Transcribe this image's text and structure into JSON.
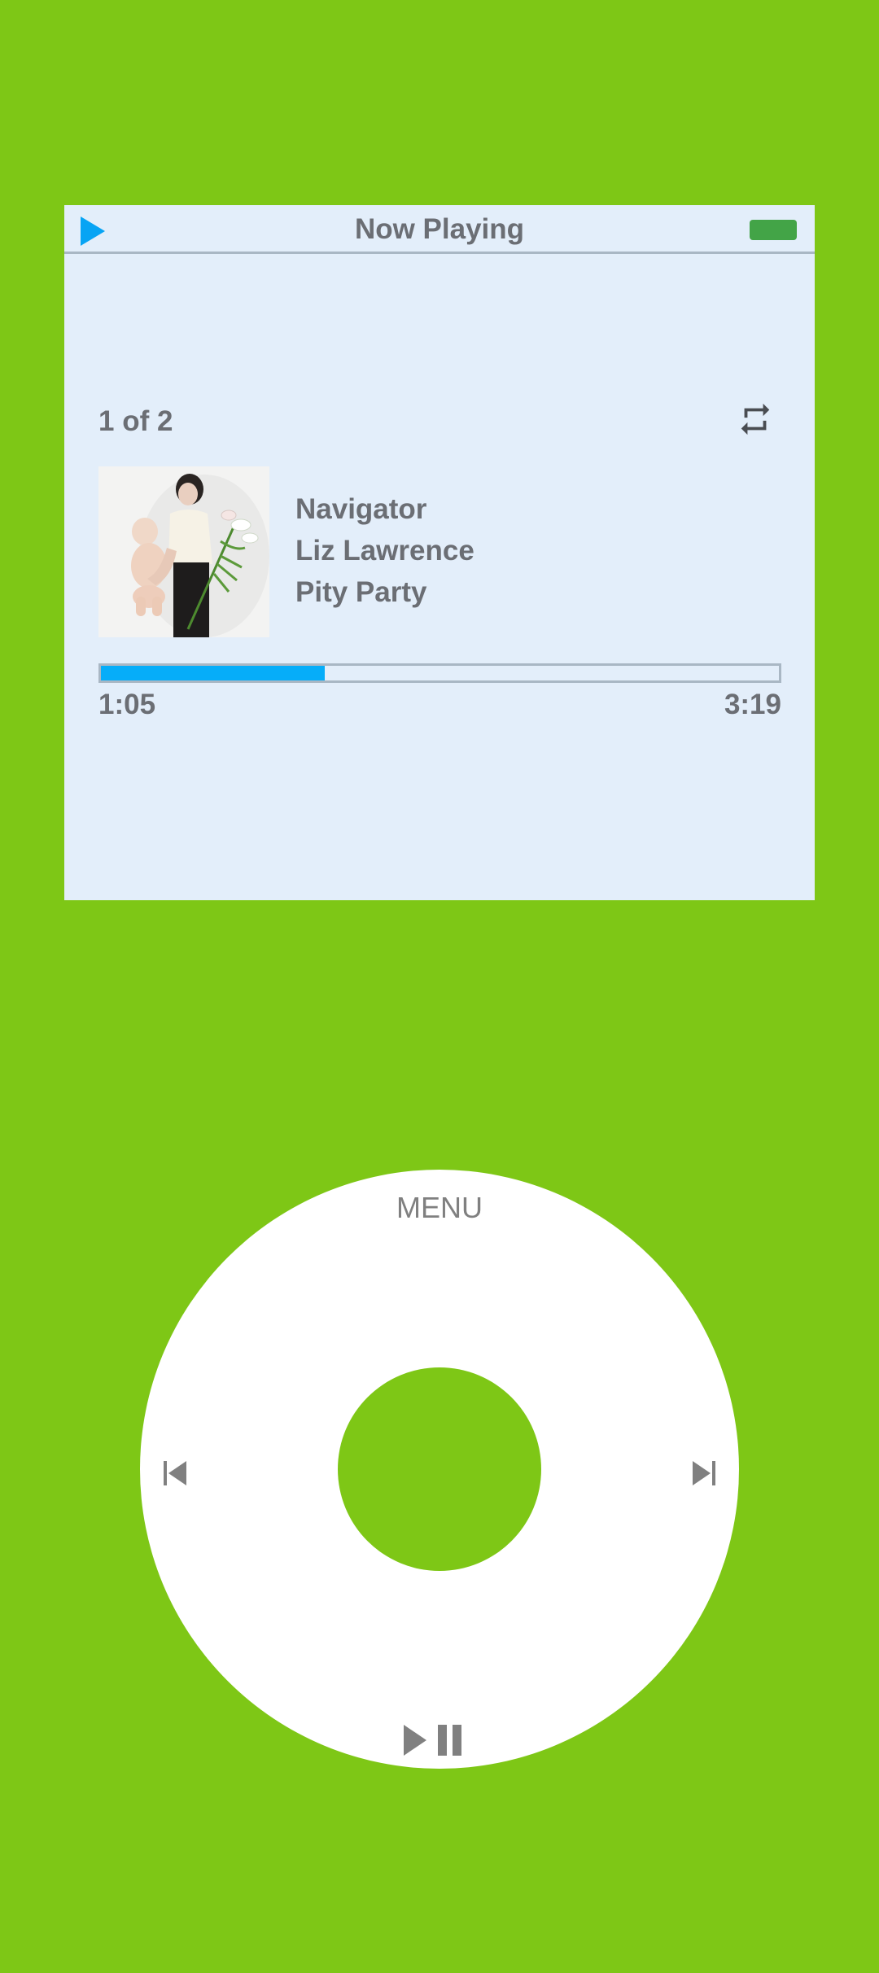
{
  "header": {
    "title": "Now Playing"
  },
  "icons": {
    "status_play": "play-icon",
    "battery": "battery-icon",
    "repeat": "repeat-icon",
    "prev": "skip-back-icon",
    "next": "skip-forward-icon",
    "play_pause": "play-pause-icon"
  },
  "player": {
    "track_index": "1 of 2",
    "song": "Navigator",
    "artist": "Liz Lawrence",
    "album": "Pity Party",
    "elapsed": "1:05",
    "duration": "3:19",
    "progress_fraction": 0.33
  },
  "wheel": {
    "menu_label": "MENU"
  },
  "colors": {
    "body_background": "#7ec716",
    "screen_background": "#e3eefa",
    "accent": "#07a4f4",
    "progress_fill": "#06adf9",
    "battery": "#43a447",
    "text": "#6b6e74",
    "wheel": "#ffffff",
    "wheel_icon": "#808080"
  }
}
